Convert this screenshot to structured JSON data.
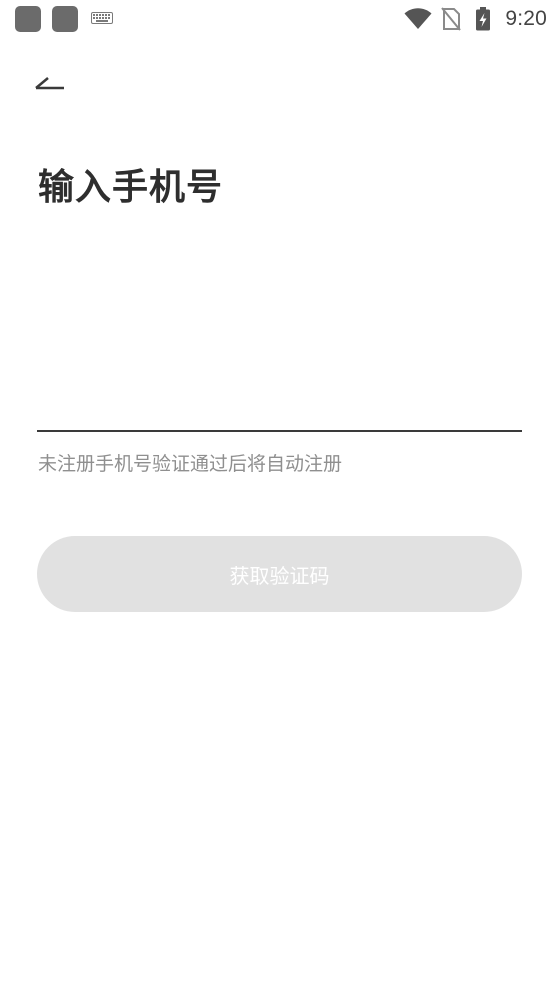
{
  "status_bar": {
    "time": "9:20",
    "icons": [
      "app-icon",
      "app-icon",
      "keyboard-icon",
      "wifi-icon",
      "no-sim-icon",
      "battery-charging-icon"
    ]
  },
  "header": {
    "back_icon": "back-arrow-icon",
    "title": "输入手机号"
  },
  "form": {
    "phone_value": "",
    "phone_placeholder": "",
    "hint": "未注册手机号验证通过后将自动注册",
    "submit_label": "获取验证码"
  },
  "colors": {
    "button_disabled_bg": "#e1e1e1",
    "button_text": "#ffffff",
    "title_text": "#2e2e2e",
    "hint_text": "#8f8f8f",
    "input_underline": "#3a3a3a"
  }
}
